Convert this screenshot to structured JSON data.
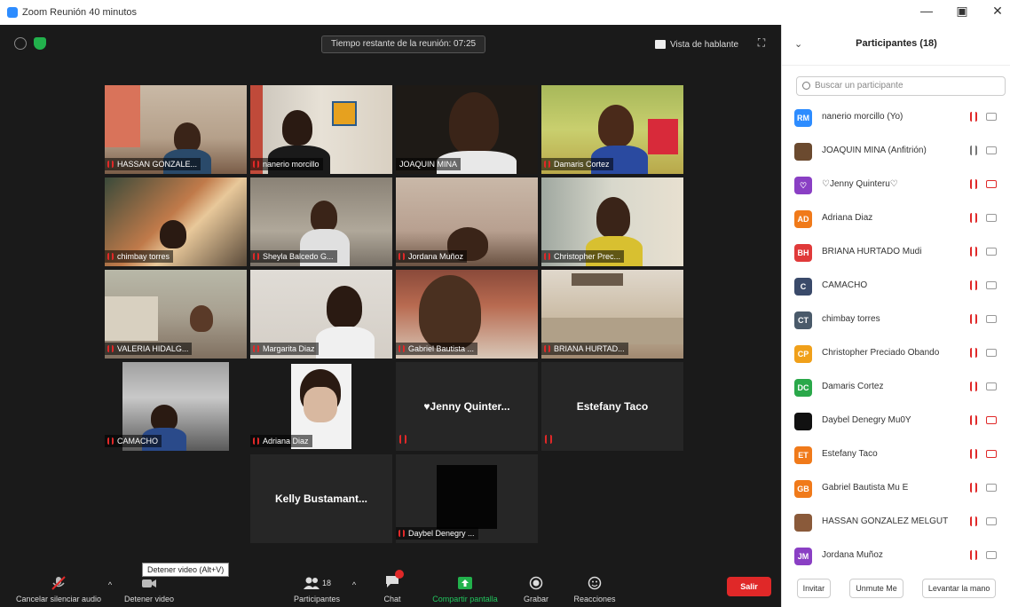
{
  "window": {
    "title": "Zoom Reunión 40 minutos",
    "controls": [
      "—",
      "▣",
      "✕"
    ]
  },
  "meeting": {
    "time_remaining": "Tiempo restante de la reunión: 07:25",
    "view_label": "Vista de hablante",
    "tooltip": "Detener video (Alt+V)"
  },
  "tiles": [
    {
      "name": "HASSAN GONZALE..."
    },
    {
      "name": "nanerio morcillo"
    },
    {
      "name": "JOAQUIN MINA"
    },
    {
      "name": "Damaris Cortez"
    },
    {
      "name": "chimbay torres"
    },
    {
      "name": "Sheyla Balcedo G..."
    },
    {
      "name": "Jordana Muñoz"
    },
    {
      "name": "Christopher Prec..."
    },
    {
      "name": "VALERIA HIDALG..."
    },
    {
      "name": "Margarita Diaz"
    },
    {
      "name": "Gabriel Bautista ..."
    },
    {
      "name": "BRIANA HURTAD..."
    },
    {
      "name": "CAMACHO"
    },
    {
      "name": "Adriana Diaz"
    },
    {
      "name": "♥Jenny Quinter..."
    },
    {
      "name": "Estefany Taco"
    },
    {
      "name": "Kelly Bustamant..."
    },
    {
      "name": "Daybel Denegry ..."
    }
  ],
  "toolbar": {
    "mute": "Cancelar silenciar audio",
    "video": "Detener video",
    "participants": "Participantes",
    "participants_count": "18",
    "chat": "Chat",
    "share": "Compartir pantalla",
    "record": "Grabar",
    "reactions": "Reacciones",
    "leave": "Salir"
  },
  "panel": {
    "title": "Participantes (18)",
    "search_placeholder": "Buscar un participante",
    "participants": [
      {
        "initials": "RM",
        "color": "#2d8cff",
        "name": "nanerio morcillo (Yo)",
        "mic": "muted",
        "cam": "on"
      },
      {
        "initials": "",
        "color": "#6b4a2f",
        "name": "JOAQUIN MINA (Anfitrión)",
        "mic": "on",
        "cam": "on"
      },
      {
        "initials": "♡",
        "color": "#8a3fc4",
        "name": "♡Jenny Quinteru♡",
        "mic": "muted",
        "cam": "off"
      },
      {
        "initials": "AD",
        "color": "#f07a1a",
        "name": "Adriana Diaz",
        "mic": "muted",
        "cam": "on"
      },
      {
        "initials": "BH",
        "color": "#e03a3a",
        "name": "BRIANA HURTADO  Mudi",
        "mic": "muted",
        "cam": "on"
      },
      {
        "initials": "C",
        "color": "#3a4a6a",
        "name": "CAMACHO",
        "mic": "muted",
        "cam": "on"
      },
      {
        "initials": "CT",
        "color": "#4a5a6a",
        "name": "chimbay torres",
        "mic": "muted",
        "cam": "on"
      },
      {
        "initials": "CP",
        "color": "#f0a01a",
        "name": "Christopher Preciado Obando",
        "mic": "muted",
        "cam": "on"
      },
      {
        "initials": "DC",
        "color": "#2aa84a",
        "name": "Damaris Cortez",
        "mic": "muted",
        "cam": "on"
      },
      {
        "initials": "",
        "color": "#111111",
        "name": "Daybel Denegry Mu0Y",
        "mic": "muted",
        "cam": "off"
      },
      {
        "initials": "ET",
        "color": "#f07a1a",
        "name": "Estefany Taco",
        "mic": "muted",
        "cam": "off"
      },
      {
        "initials": "GB",
        "color": "#f07a1a",
        "name": "Gabriel Bautista Mu E",
        "mic": "muted",
        "cam": "on"
      },
      {
        "initials": "",
        "color": "#8a5a3a",
        "name": "HASSAN GONZALEZ MELGUT",
        "mic": "muted",
        "cam": "on"
      },
      {
        "initials": "JM",
        "color": "#8a3fc4",
        "name": "Jordana Muñoz",
        "mic": "muted",
        "cam": "on"
      }
    ],
    "footer": {
      "invite": "Invitar",
      "unmute": "Unmute Me",
      "raise_hand": "Levantar la mano"
    }
  }
}
